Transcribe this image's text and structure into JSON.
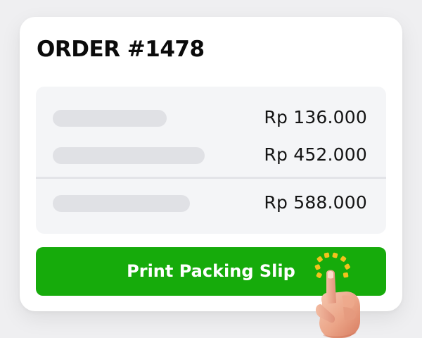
{
  "order": {
    "title": "ORDER #1478"
  },
  "line_items": [
    {
      "price": "Rp 136.000"
    },
    {
      "price": "Rp 452.000"
    }
  ],
  "total": {
    "price": "Rp 588.000"
  },
  "action": {
    "label": "Print Packing Slip"
  },
  "colors": {
    "button": "#16ab0b",
    "card": "#ffffff",
    "summary_background": "#f4f5f7",
    "placeholder": "#e0e1e5",
    "click_indicator": "#f2c21c"
  },
  "icons": {
    "pointer": "pointing-hand-icon",
    "click": "click-burst-icon"
  }
}
